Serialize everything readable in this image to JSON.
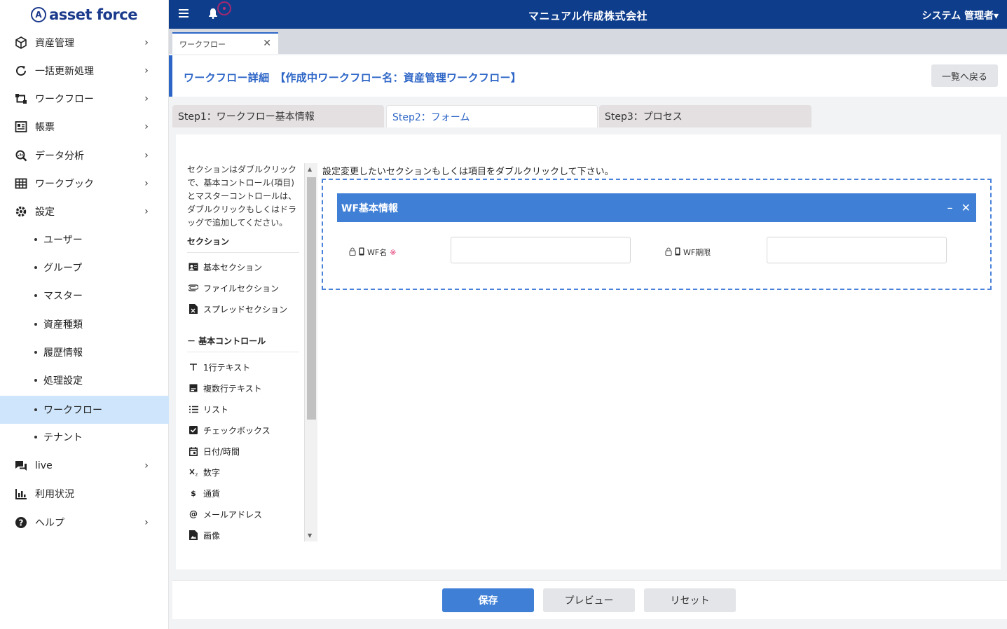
{
  "app": {
    "logo_text": "asset force",
    "company": "マニュアル作成株式会社",
    "user_menu": "システム 管理者▾"
  },
  "sidebar": {
    "items": [
      {
        "label": "資産管理",
        "icon": "box-icon",
        "chevron": true
      },
      {
        "label": "一括更新処理",
        "icon": "refresh-icon",
        "chevron": true
      },
      {
        "label": "ワークフロー",
        "icon": "workflow-icon",
        "chevron": true
      },
      {
        "label": "帳票",
        "icon": "report-icon",
        "chevron": true
      },
      {
        "label": "データ分析",
        "icon": "analytics-icon",
        "chevron": true
      },
      {
        "label": "ワークブック",
        "icon": "table-icon",
        "chevron": true
      },
      {
        "label": "設定",
        "icon": "gear-icon",
        "chevron": true
      }
    ],
    "sub_items": [
      "ユーザー",
      "グループ",
      "マスター",
      "資産種類",
      "履歴情報",
      "処理設定",
      "ワークフロー",
      "テナント"
    ],
    "active_sub": "ワークフロー",
    "bottom_items": [
      {
        "label": "live",
        "icon": "chat-icon",
        "chevron": true
      },
      {
        "label": "利用状況",
        "icon": "bar-chart-icon",
        "chevron": false
      },
      {
        "label": "ヘルプ",
        "icon": "help-icon",
        "chevron": true
      }
    ]
  },
  "tabs": {
    "doc_tab_label": "ワークフロー"
  },
  "page": {
    "title": "ワークフロー詳細　【作成中ワークフロー名：資産管理ワークフロー】",
    "back_button": "一覧へ戻る",
    "steps": [
      "Step1：ワークフロー基本情報",
      "Step2：フォーム",
      "Step3：プロセス"
    ],
    "active_step": "Step2：フォーム"
  },
  "palette": {
    "description": "セクションはダブルクリックで、基本コントロール(項目)とマスターコントロールは、ダブルクリックもしくはドラッグで追加してください。",
    "section_header": "セクション",
    "sections": [
      {
        "label": "基本セクション",
        "icon": "id-card-icon"
      },
      {
        "label": "ファイルセクション",
        "icon": "paperclip-icon"
      },
      {
        "label": "スプレッドセクション",
        "icon": "spreadsheet-icon"
      }
    ],
    "controls_header": "－ 基本コントロール",
    "controls": [
      {
        "label": "1行テキスト",
        "icon": "text-icon"
      },
      {
        "label": "複数行テキスト",
        "icon": "multiline-text-icon"
      },
      {
        "label": "リスト",
        "icon": "list-icon"
      },
      {
        "label": "チェックボックス",
        "icon": "checkbox-icon"
      },
      {
        "label": "日付/時間",
        "icon": "calendar-icon"
      },
      {
        "label": "数字",
        "icon": "number-icon"
      },
      {
        "label": "通貨",
        "icon": "currency-icon"
      },
      {
        "label": "メールアドレス",
        "icon": "at-icon"
      },
      {
        "label": "画像",
        "icon": "image-icon"
      }
    ]
  },
  "canvas": {
    "hint": "設定変更したいセクションもしくは項目をダブルクリックして下さい。",
    "section_title": "WF基本情報",
    "fields": [
      {
        "label": "WF名",
        "required_mark": "※",
        "value": ""
      },
      {
        "label": "WF期限",
        "required_mark": "",
        "value": ""
      }
    ]
  },
  "footer": {
    "save": "保存",
    "preview": "プレビュー",
    "reset": "リセット"
  },
  "colors": {
    "header_bg": "#0e3d8c",
    "accent": "#2e66c7",
    "section_bg": "#3f7fd6",
    "active_nav_bg": "#cfe5fb",
    "required": "#e0306d"
  }
}
